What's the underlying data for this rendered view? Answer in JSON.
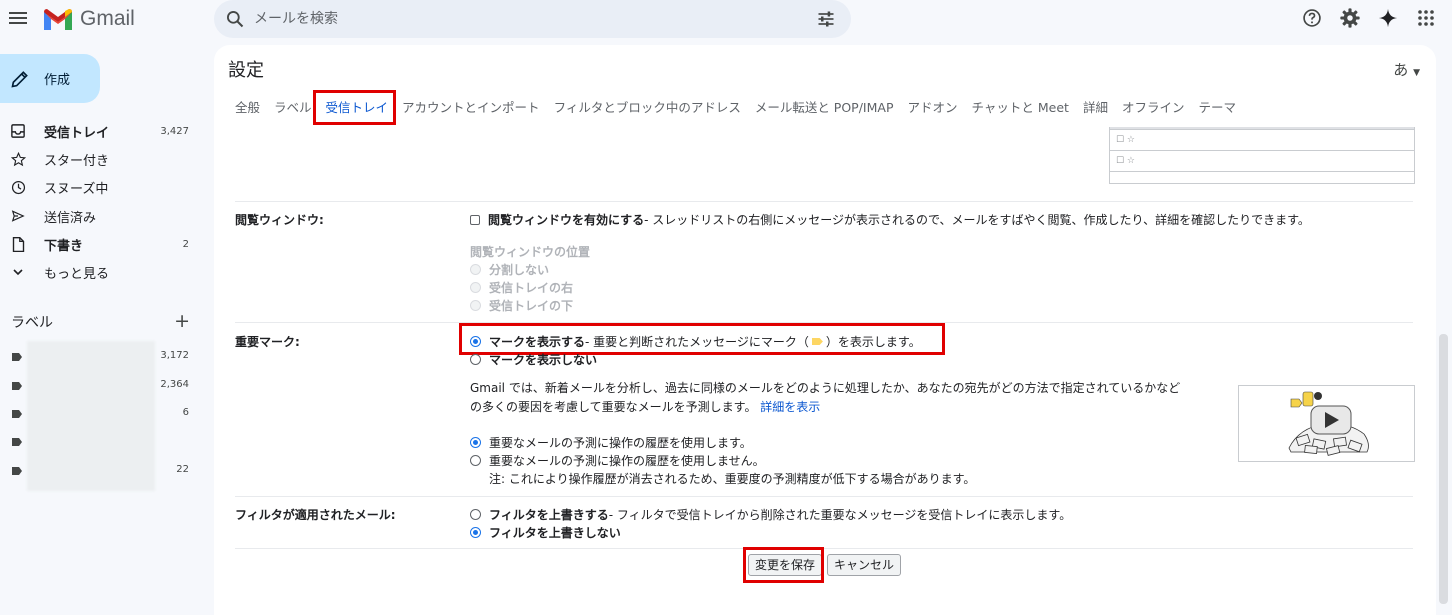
{
  "app": {
    "name": "Gmail"
  },
  "search": {
    "placeholder": "メールを検索"
  },
  "compose": {
    "label": "作成"
  },
  "nav": [
    {
      "label": "受信トレイ",
      "count": "3,427",
      "bold": true,
      "icon": "inbox-icon"
    },
    {
      "label": "スター付き",
      "count": "",
      "bold": false,
      "icon": "star-icon"
    },
    {
      "label": "スヌーズ中",
      "count": "",
      "bold": false,
      "icon": "clock-icon"
    },
    {
      "label": "送信済み",
      "count": "",
      "bold": false,
      "icon": "send-icon"
    },
    {
      "label": "下書き",
      "count": "2",
      "bold": true,
      "icon": "draft-icon"
    },
    {
      "label": "もっと見る",
      "count": "",
      "bold": false,
      "icon": "chevron-down-icon"
    }
  ],
  "labels": {
    "title": "ラベル",
    "add": "+",
    "items": [
      {
        "count": "3,172"
      },
      {
        "count": "2,364"
      },
      {
        "count": "6"
      },
      {
        "count": ""
      },
      {
        "count": "22"
      }
    ]
  },
  "settings": {
    "title": "設定",
    "input_tool": "あ",
    "tabs": [
      "全般",
      "ラベル",
      "受信トレイ",
      "アカウントとインポート",
      "フィルタとブロック中のアドレス",
      "メール転送と POP/IMAP",
      "アドオン",
      "チャットと Meet",
      "詳細",
      "オフライン",
      "テーマ"
    ],
    "active_tab_index": 2,
    "preview_rows": [
      "☐ ☆",
      "☐ ☆"
    ],
    "reading_pane": {
      "label": "閲覧ウィンドウ:",
      "enable_label": "閲覧ウィンドウを有効にする",
      "enable_desc": " - スレッドリストの右側にメッセージが表示されるので、メールをすばやく閲覧、作成したり、詳細を確認したりできます。",
      "enabled": false,
      "position_title": "閲覧ウィンドウの位置",
      "positions": [
        "分割しない",
        "受信トレイの右",
        "受信トレイの下"
      ]
    },
    "importance": {
      "label": "重要マーク:",
      "show_label": "マークを表示する",
      "show_desc_pre": " - 重要と判断されたメッセージにマーク（",
      "show_desc_post": "）を表示します。",
      "hide_label": "マークを表示しない",
      "selected": "show",
      "info_line1": "Gmail では、新着メールを分析し、過去に同様のメールをどのように処理したか、あなたの宛先がどの方法で指定されているかなど",
      "info_line2": "の多くの要因を考慮して重要なメールを予測します。",
      "learn_more": "詳細を表示",
      "history_use": "重要なメールの予測に操作の履歴を使用します。",
      "history_not_use": "重要なメールの予測に操作の履歴を使用しません。",
      "history_note": "注: これにより操作履歴が消去されるため、重要度の予測精度が低下する場合があります。",
      "history_selected": "use"
    },
    "filtered": {
      "label": "フィルタが適用されたメール:",
      "override_label": "フィルタを上書きする",
      "override_desc": " - フィルタで受信トレイから削除された重要なメッセージを受信トレイに表示します。",
      "no_override_label": "フィルタを上書きしない",
      "selected": "no_override"
    },
    "save_label": "変更を保存",
    "cancel_label": "キャンセル"
  },
  "colors": {
    "accent": "#0b57d0",
    "compose_bg": "#c2e7ff",
    "highlight": "#e00000"
  }
}
